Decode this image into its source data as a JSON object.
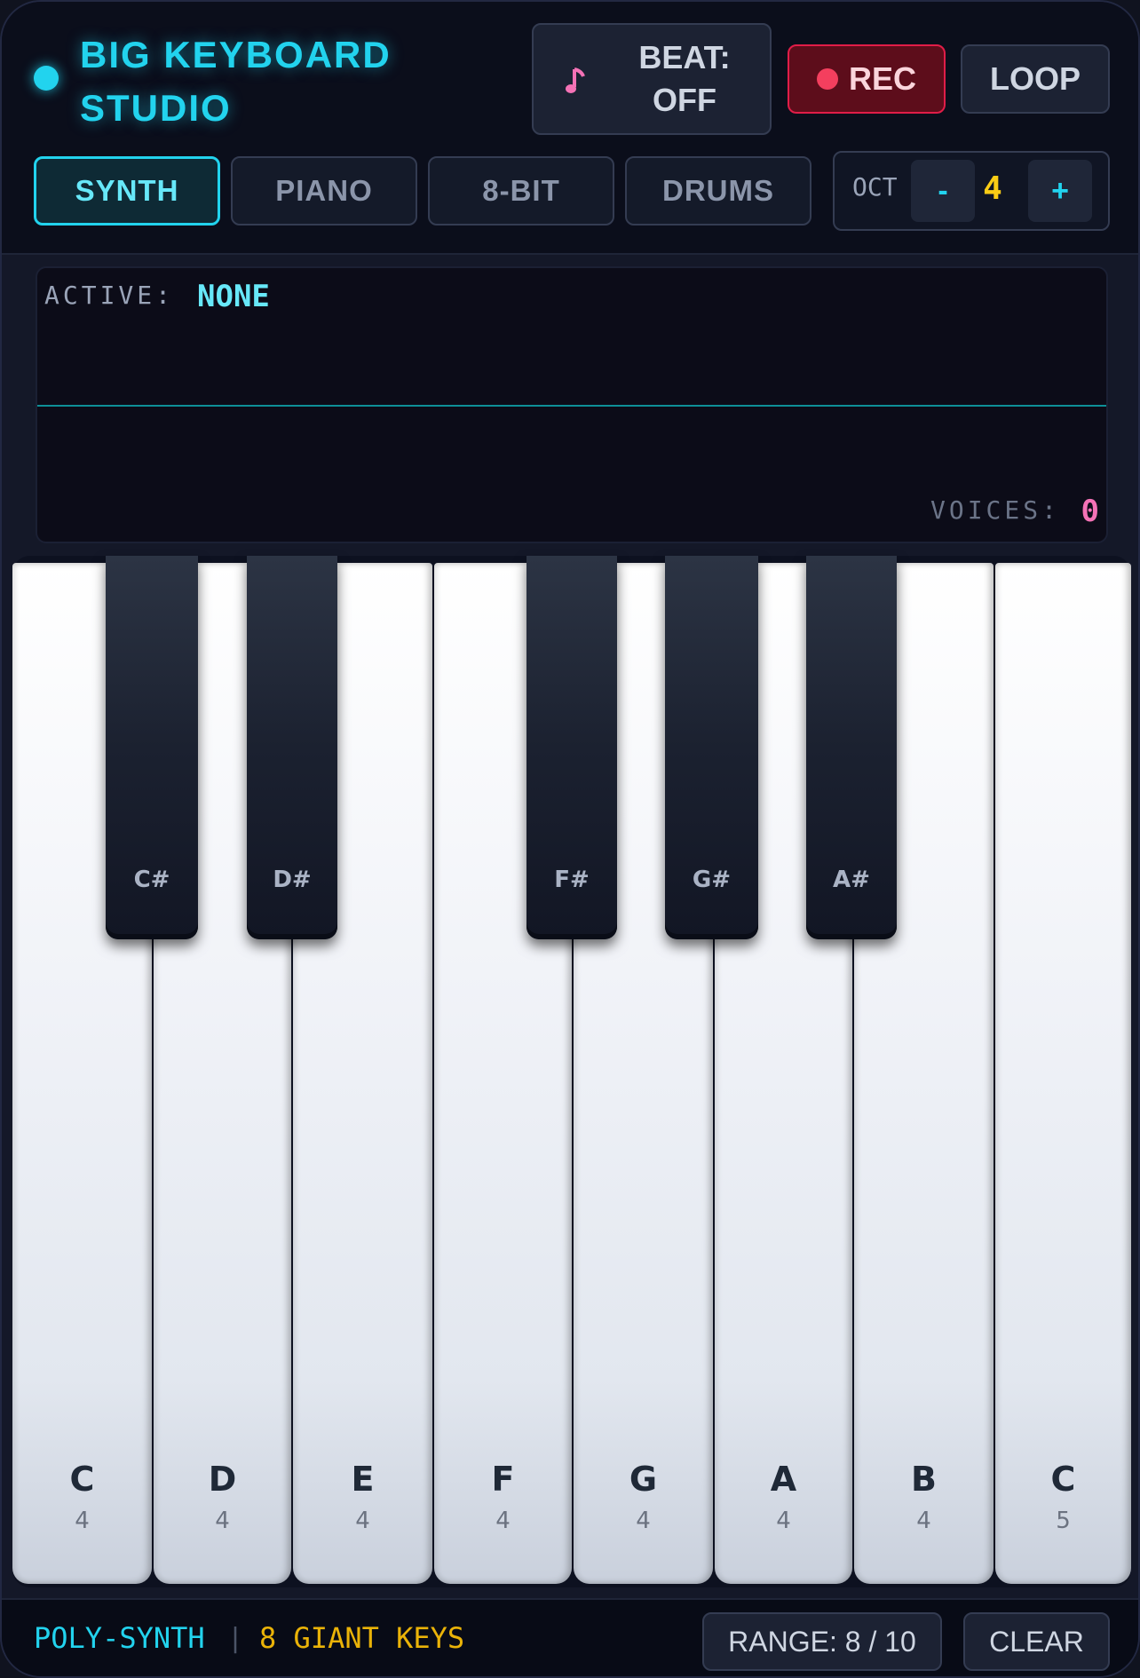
{
  "header": {
    "title": "BIG KEYBOARD STUDIO",
    "beat_label": "BEAT: OFF",
    "rec_label": "REC",
    "loop_label": "LOOP",
    "icons": {
      "beat": "music-note-icon",
      "rec": "record-dot-icon",
      "status": "status-dot-icon"
    }
  },
  "tabs": [
    {
      "label": "SYNTH",
      "active": true
    },
    {
      "label": "PIANO",
      "active": false
    },
    {
      "label": "8-BIT",
      "active": false
    },
    {
      "label": "DRUMS",
      "active": false
    }
  ],
  "octave": {
    "label": "OCT",
    "minus": "-",
    "plus": "+",
    "value": "4"
  },
  "display": {
    "active_label": "ACTIVE:",
    "active_value": "NONE",
    "voices_label": "VOICES:",
    "voices_value": "0"
  },
  "keys": {
    "white": [
      {
        "note": "C",
        "octave": "4"
      },
      {
        "note": "D",
        "octave": "4"
      },
      {
        "note": "E",
        "octave": "4"
      },
      {
        "note": "F",
        "octave": "4"
      },
      {
        "note": "G",
        "octave": "4"
      },
      {
        "note": "A",
        "octave": "4"
      },
      {
        "note": "B",
        "octave": "4"
      },
      {
        "note": "C",
        "octave": "5"
      }
    ],
    "black": [
      {
        "note": "C#"
      },
      {
        "note": "D#"
      },
      {
        "note": "F#"
      },
      {
        "note": "G#"
      },
      {
        "note": "A#"
      }
    ]
  },
  "footer": {
    "mode": "POLY-SYNTH",
    "separator": "|",
    "keys_text": "8 GIANT KEYS",
    "range_label": "RANGE: 8 / 10",
    "clear_label": "CLEAR"
  },
  "colors": {
    "accent": "#22d3ee",
    "rec": "#e11d48",
    "octave_value": "#facc15",
    "voices_value": "#f472b6",
    "footer_keys": "#eab308"
  }
}
